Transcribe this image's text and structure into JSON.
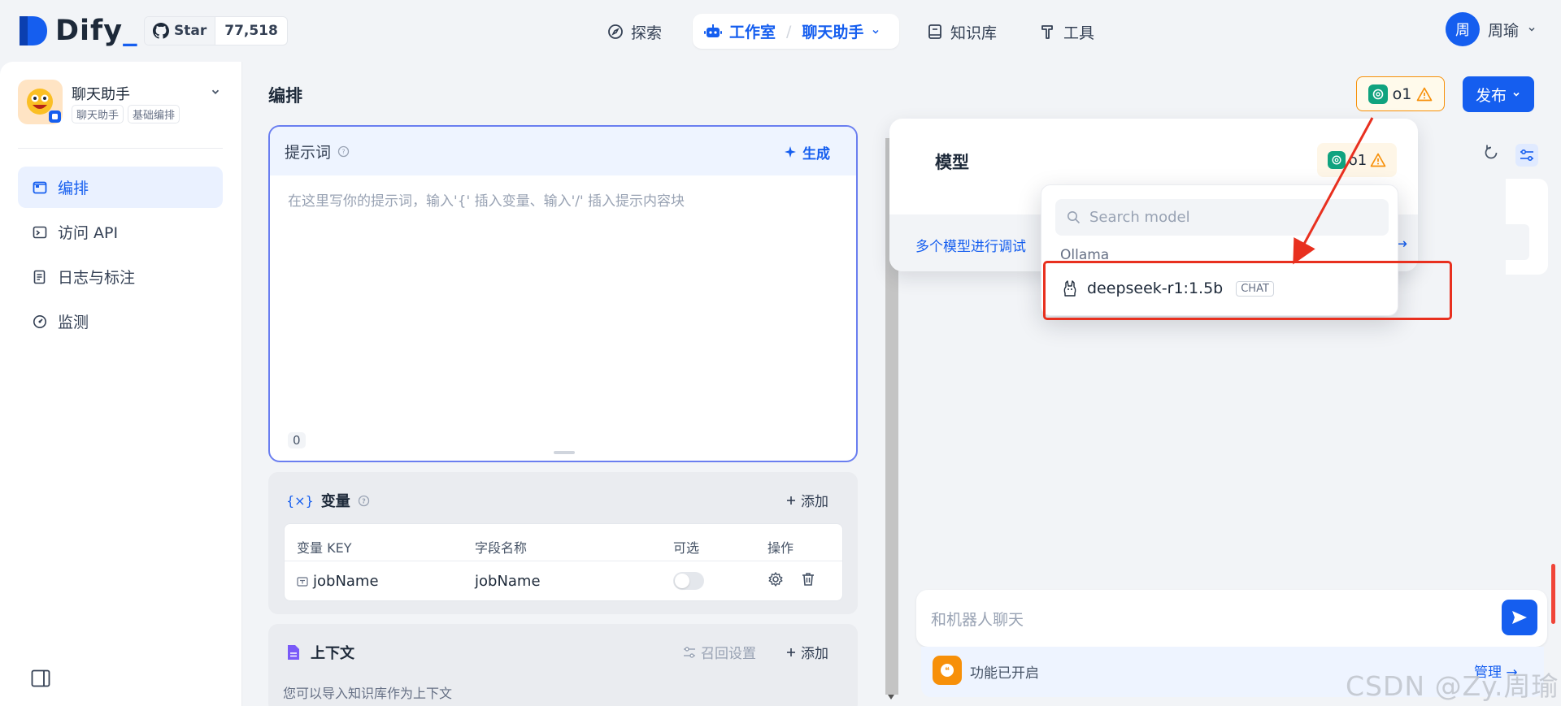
{
  "app": {
    "logo_text": "Dify",
    "logo_underscore": "_"
  },
  "github": {
    "star_label": "Star",
    "star_count": "77,518"
  },
  "nav": {
    "explore": "探索",
    "studio": "工作室",
    "studio_separator": "/",
    "current_app": "聊天助手",
    "knowledge": "知识库",
    "tools": "工具"
  },
  "user": {
    "avatar_initial": "周",
    "name": "周瑜"
  },
  "sidebar": {
    "app_name": "聊天助手",
    "app_tags": [
      "聊天助手",
      "基础编排"
    ],
    "items": [
      {
        "label": "编排",
        "icon": "layout-icon",
        "active": true
      },
      {
        "label": "访问 API",
        "icon": "terminal-icon",
        "active": false
      },
      {
        "label": "日志与标注",
        "icon": "log-icon",
        "active": false
      },
      {
        "label": "监测",
        "icon": "gauge-icon",
        "active": false
      }
    ]
  },
  "main": {
    "title": "编排"
  },
  "header": {
    "model_name": "o1",
    "publish_label": "发布"
  },
  "prompt": {
    "title": "提示词",
    "generate_label": "生成",
    "placeholder": "在这里写你的提示词，输入'{' 插入变量、输入'/' 插入提示内容块",
    "char_count": "0"
  },
  "variables": {
    "title": "变量",
    "add_label": "添加",
    "columns": [
      "变量 KEY",
      "字段名称",
      "可选",
      "操作"
    ],
    "rows": [
      {
        "key": "jobName",
        "name": "jobName",
        "optional": false
      }
    ]
  },
  "context": {
    "title": "上下文",
    "recall_label": "召回设置",
    "add_label": "添加",
    "description": "您可以导入知识库作为上下文"
  },
  "model_popup": {
    "title": "模型",
    "model_name": "o1",
    "multi_model_label": "多个模型进行调试",
    "arrow": "→"
  },
  "model_dropdown": {
    "search_placeholder": "Search model",
    "provider": "Ollama",
    "items": [
      {
        "name": "deepseek-r1:1.5b",
        "tag": "CHAT"
      }
    ]
  },
  "chat": {
    "placeholder": "和机器人聊天",
    "features_label": "功能已开启",
    "manage_label": "管理 →"
  },
  "watermark": "CSDN @Zy.周瑜",
  "colors": {
    "primary": "#155eef",
    "warning": "#f79009",
    "annotation_red": "#e8301f",
    "gpt_green": "#10a37f"
  }
}
